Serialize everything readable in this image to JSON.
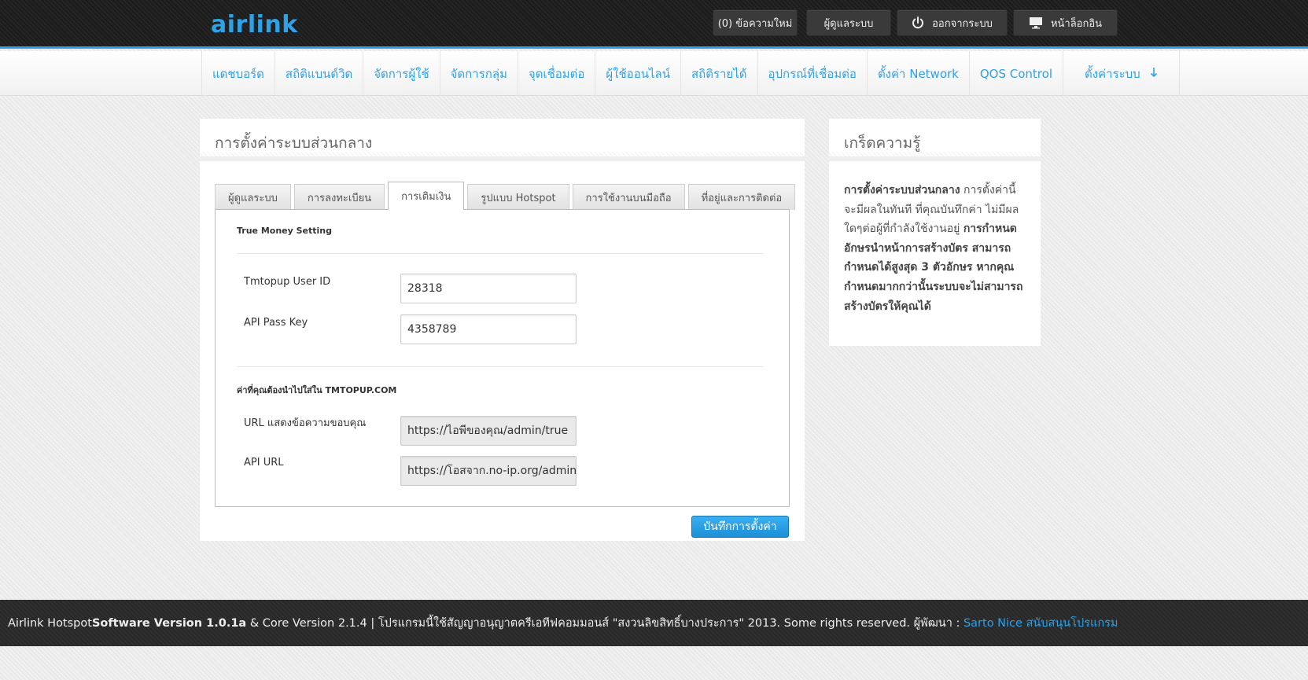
{
  "brand": {
    "logo": "airlink",
    "accent": "#2fa1e6"
  },
  "topbar": {
    "messages_label": "(0) ข้อความใหม่",
    "admin_label": "ผู้ดูแลระบบ",
    "logout_label": "ออกจากระบบ",
    "login_page_label": "หน้าล็อกอิน"
  },
  "nav": {
    "items": [
      "แดชบอร์ด",
      "สถิติแบนด์วิด",
      "จัดการผู้ใช้",
      "จัดการกลุ่ม",
      "จุดเชื่อมต่อ",
      "ผู้ใช้ออนไลน์",
      "สถิติรายได้",
      "อุปกรณ์ที่เชื่อมต่อ",
      "ตั้งค่า Network",
      "QOS Control",
      "ตั้งค่าระบบ"
    ]
  },
  "main": {
    "title": "การตั้งค่าระบบส่วนกลาง",
    "tabs": [
      "ผู้ดูแลระบบ",
      "การลงทะเบียน",
      "การเติมเงิน",
      "รูปแบบ Hotspot",
      "การใช้งานบนมือถือ",
      "ที่อยู่และการติดต่อ"
    ],
    "active_tab": "การเติมเงิน",
    "section1": "True Money Setting",
    "fields": [
      {
        "label": "Tmtopup User ID",
        "value": "28318"
      },
      {
        "label": "API Pass Key",
        "value": "4358789"
      }
    ],
    "section2": "ค่าที่คุณต้องนำไปใส่ใน TMTOPUP.COM",
    "url_fields": [
      {
        "label": "URL แสดงข้อความขอบคุณ",
        "value": "https://ไอพีของคุณ/admin/true"
      },
      {
        "label": "API URL",
        "value": "https://โอสจาก.no-ip.org/admin/"
      }
    ],
    "save_label": "บันทึกการตั้งค่า"
  },
  "sidebar": {
    "title": "เกร็ดความรู้",
    "bold1": "การตั้งค่าระบบส่วนกลาง",
    "text1": " การตั้งค่านี้จะมีผลในทันที ที่คุณบันทึกค่า ไม่มีผลใดๆต่อผู้ที่กำลังใช้งานอยู่ ",
    "bold2": "การกำหนดอักษรนำหน้าการสร้างบัตร สามารถกำหนดได้สูงสุด 3 ตัวอักษร หากคุณกำหนดมากกว่านั้นระบบจะไม่สามารถสร้างบัตรให้คุณได้"
  },
  "footer": {
    "app": "Airlink Hotspot ",
    "version": "Software Version 1.0.1a",
    "rest": " & Core Version 2.1.4 | โปรแกรมนี้ใช้สัญญาอนุญาตครีเอทีฟคอมมอนส์ \"สงวนลิขสิทธิ์บางประการ\" 2013. Some rights reserved. ผู้พัฒนา : ",
    "developer": "Sarto Nice สนับสนุนโปรแกรม"
  }
}
